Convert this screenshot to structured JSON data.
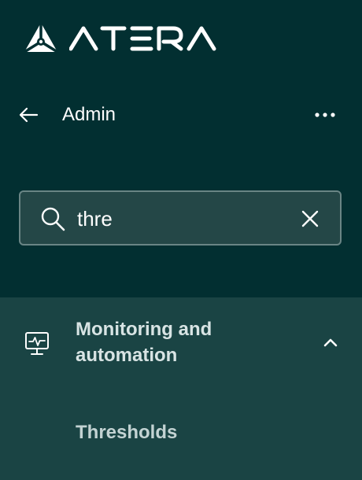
{
  "brand": {
    "name": "ATERA",
    "logo_icon": "atera-triangle-logo"
  },
  "topbar": {
    "title": "Admin",
    "back_icon": "arrow-left-icon",
    "more_icon": "ellipsis-icon"
  },
  "search": {
    "value": "thre",
    "search_icon": "search-icon",
    "clear_icon": "close-icon"
  },
  "section": {
    "title": "Monitoring and automation",
    "icon": "monitor-pulse-icon",
    "expanded": true,
    "items": [
      {
        "label": "Thresholds"
      }
    ]
  },
  "colors": {
    "background": "#022f31",
    "section_bg": "#1a4444",
    "search_bg": "#244747",
    "search_border": "#6a8585",
    "text": "#ffffff",
    "section_text": "#d8e4e4"
  }
}
